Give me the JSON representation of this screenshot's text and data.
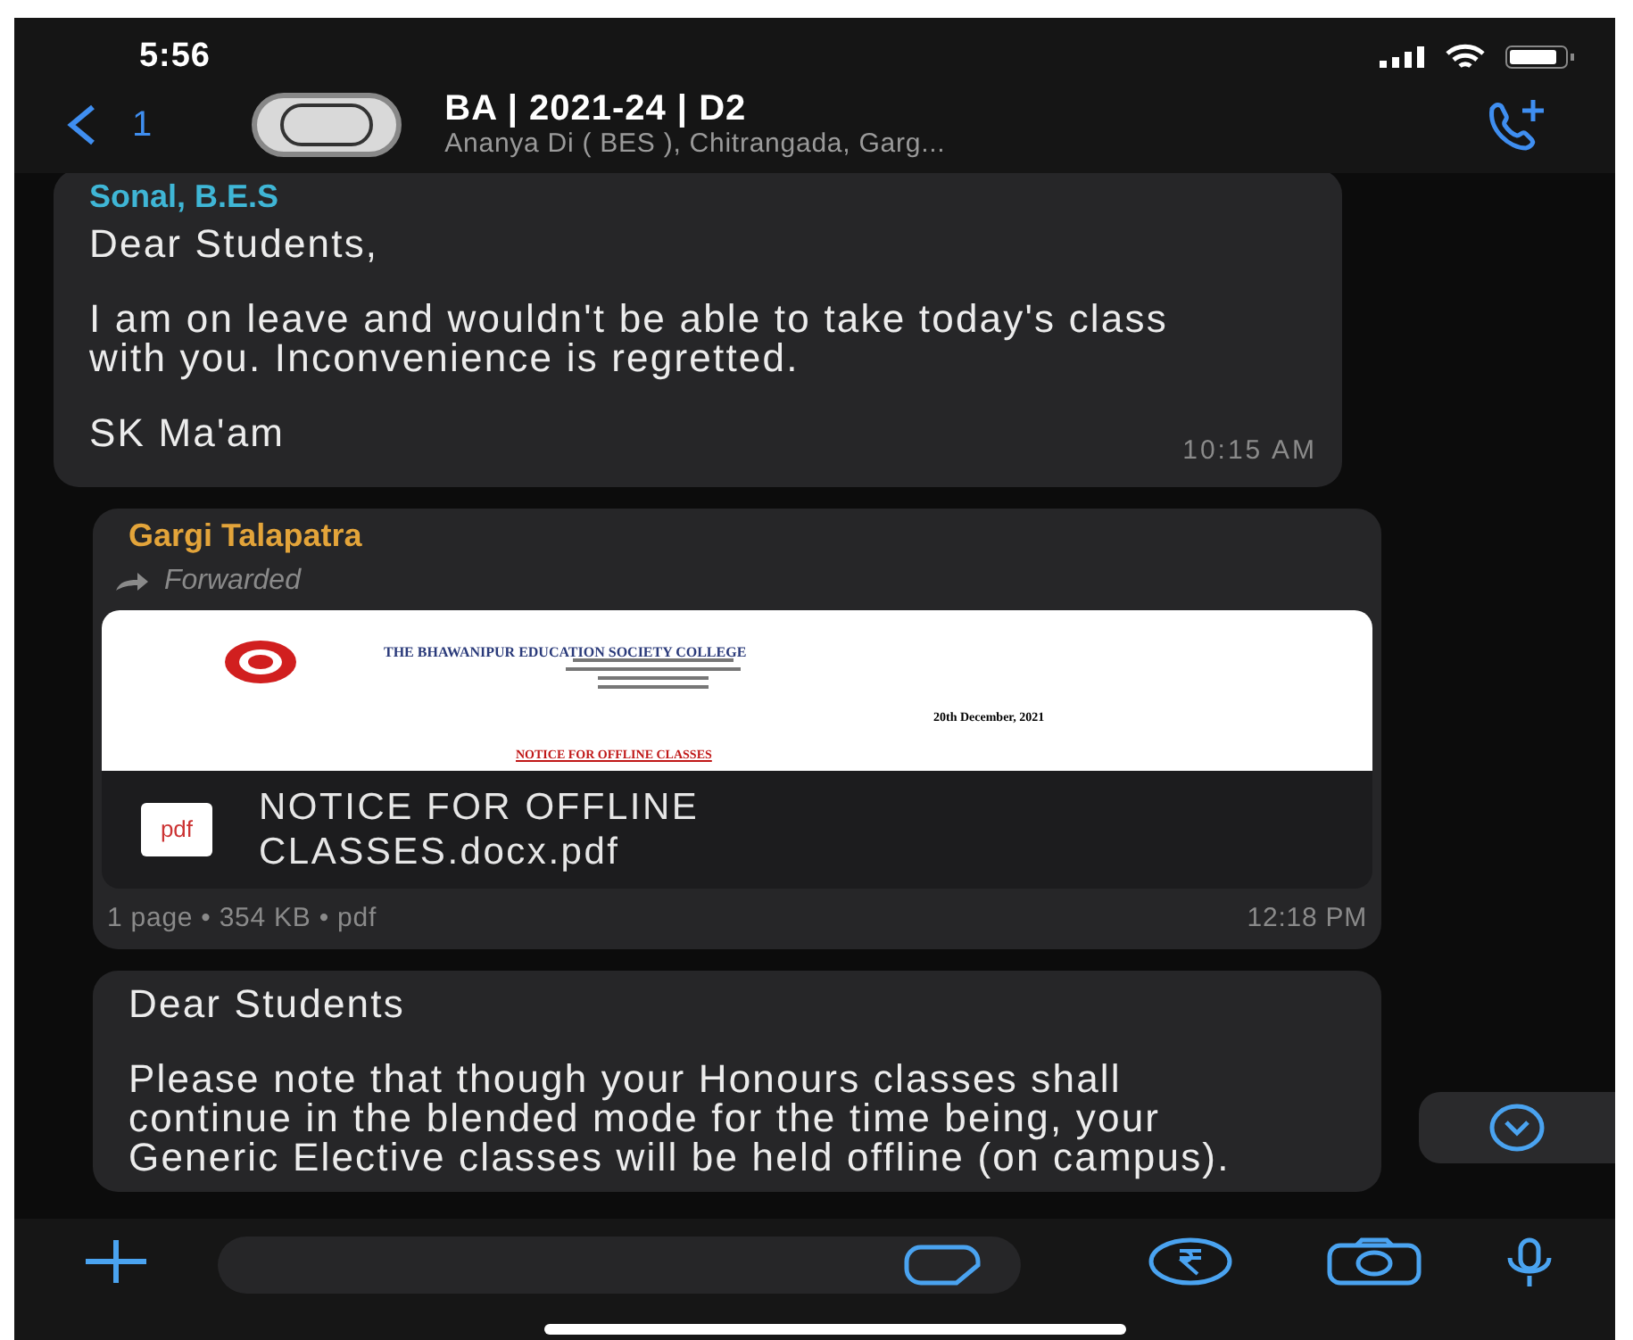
{
  "status_bar": {
    "time": "5:56"
  },
  "header": {
    "back_count": "1",
    "title": "BA | 2021-24 | D2",
    "subtitle": "Ananya Di ( BES ), Chitrangada, Garg..."
  },
  "messages": [
    {
      "kind": "text",
      "sender": "Sonal, B.E.S",
      "color": "#3fb6d6",
      "paragraphs": [
        "Dear Students,",
        "I am on leave and wouldn't be able to take today's class with you. Inconvenience is regretted.",
        "SK Ma'am"
      ],
      "time": "10:15 AM"
    },
    {
      "kind": "document",
      "sender": "Gargi Talapatra",
      "color": "#e3a43a",
      "forwarded": "Forwarded",
      "preview": {
        "college": "THE BHAWANIPUR EDUCATION SOCIETY COLLEGE",
        "date": "20th December, 2021",
        "heading": "NOTICE FOR OFFLINE CLASSES"
      },
      "file_type": "pdf",
      "file_name": "NOTICE FOR OFFLINE CLASSES.docx.pdf",
      "meta": "1 page • 354 KB • pdf",
      "time": "12:18 PM"
    },
    {
      "kind": "text",
      "paragraphs": [
        "Dear Students",
        "Please note that though your Honours classes shall continue in the blended mode for the time being, your Generic Elective classes will be held offline (on campus)."
      ]
    }
  ]
}
